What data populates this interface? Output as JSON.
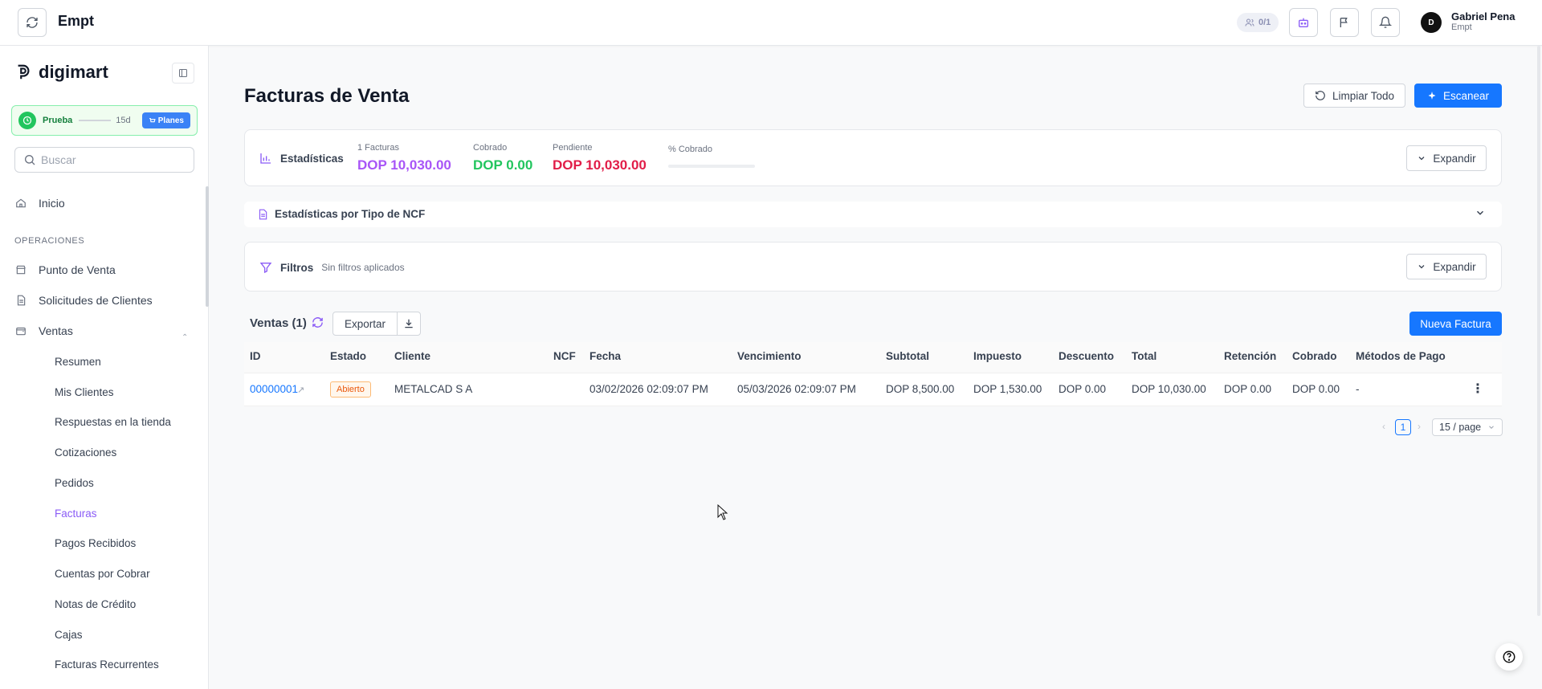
{
  "topbar": {
    "app_title": "Empt",
    "users_badge": "0/1",
    "user_name": "Gabriel Pena",
    "user_org": "Empt",
    "avatar_initials": "D"
  },
  "sidebar": {
    "logo_text": "digimart",
    "trial": {
      "label": "Prueba",
      "days": "15d",
      "plans_label": "Planes"
    },
    "search_placeholder": "Buscar",
    "home_label": "Inicio",
    "section_label": "OPERACIONES",
    "items": [
      {
        "label": "Punto de Venta",
        "icon": "store-icon"
      },
      {
        "label": "Solicitudes de Clientes",
        "icon": "document-icon"
      },
      {
        "label": "Ventas",
        "icon": "wallet-icon"
      }
    ],
    "sub_items": [
      "Resumen",
      "Mis Clientes",
      "Respuestas en la tienda",
      "Cotizaciones",
      "Pedidos",
      "Facturas",
      "Pagos Recibidos",
      "Cuentas por Cobrar",
      "Notas de Crédito",
      "Cajas",
      "Facturas Recurrentes"
    ],
    "active_sub_item": "Facturas"
  },
  "main": {
    "page_title": "Facturas de Venta",
    "clear_all_label": "Limpiar Todo",
    "scan_label": "Escanear",
    "stats": {
      "title": "Estadísticas",
      "invoices_label": "1 Facturas",
      "invoices_value": "DOP 10,030.00",
      "collected_label": "Cobrado",
      "collected_value": "DOP 0.00",
      "pending_label": "Pendiente",
      "pending_value": "DOP 10,030.00",
      "pct_label": "% Cobrado",
      "pct_collected": 0,
      "expand_label": "Expandir"
    },
    "ncf_stats_title": "Estadísticas por Tipo de NCF",
    "filters": {
      "title": "Filtros",
      "subtitle": "Sin filtros aplicados",
      "expand_label": "Expandir"
    },
    "sales_title": "Ventas (1)",
    "export_label": "Exportar",
    "new_invoice_label": "Nueva Factura",
    "columns": [
      "ID",
      "Estado",
      "Cliente",
      "NCF",
      "Fecha",
      "Vencimiento",
      "Subtotal",
      "Impuesto",
      "Descuento",
      "Total",
      "Retención",
      "Cobrado",
      "Métodos de Pago"
    ],
    "rows": [
      {
        "id": "00000001",
        "status": "Abierto",
        "client": "METALCAD S A",
        "ncf": "",
        "date": "03/02/2026 02:09:07 PM",
        "due": "05/03/2026 02:09:07 PM",
        "subtotal": "DOP 8,500.00",
        "tax": "DOP 1,530.00",
        "discount": "DOP 0.00",
        "total": "DOP 10,030.00",
        "withholding": "DOP 0.00",
        "collected": "DOP 0.00",
        "payment_methods": "-"
      }
    ],
    "pagination": {
      "current_page": "1",
      "page_size": "15 / page"
    }
  },
  "colors": {
    "accent": "#8b5cf6",
    "primary": "#1677ff",
    "success": "#22c55e",
    "danger": "#e11d48"
  }
}
